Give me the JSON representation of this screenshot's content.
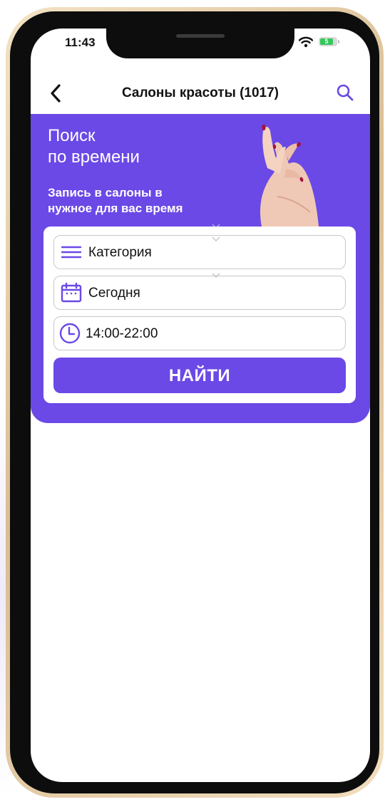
{
  "status_bar": {
    "time": "11:43",
    "battery": "5"
  },
  "nav": {
    "title": "Салоны красоты (1017)"
  },
  "hero": {
    "title": "Поиск\nпо времени",
    "subtitle": "Запись в  салоны в\nнужное для вас время"
  },
  "form": {
    "category": "Категория",
    "date": "Сегодня",
    "time_range": "14:00-22:00",
    "submit_label": "НАЙТИ"
  },
  "icons": {
    "back": "chevron-left-icon",
    "search": "search-icon",
    "category": "menu-lines-icon",
    "date": "calendar-icon",
    "time": "clock-icon"
  },
  "colors": {
    "accent": "#6b49e6",
    "background": "#ffffff"
  }
}
